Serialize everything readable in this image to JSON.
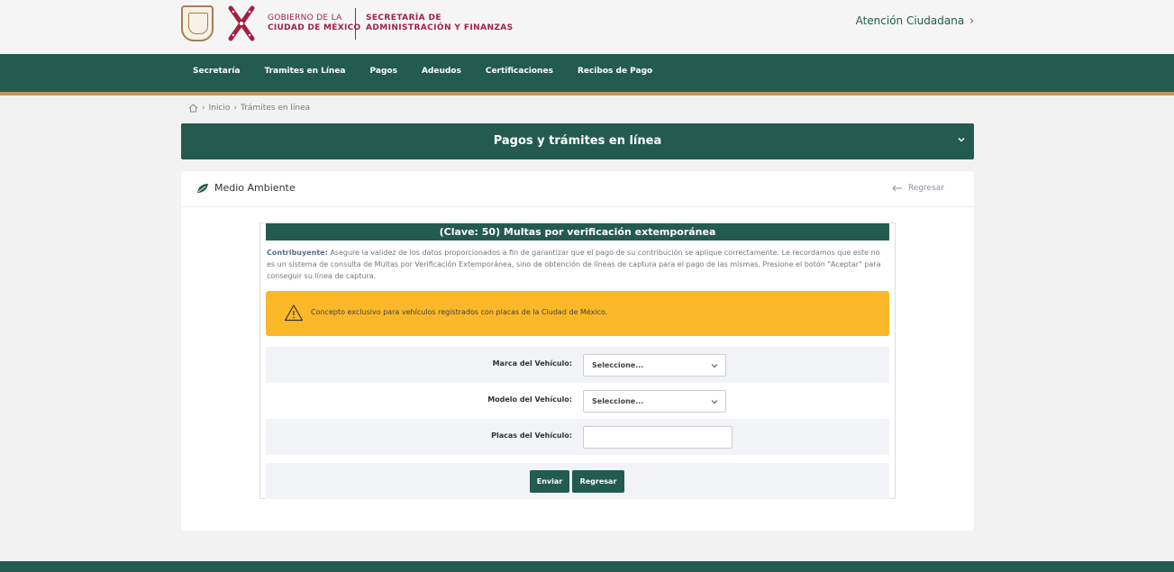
{
  "header": {
    "gov_line1": "GOBIERNO DE LA",
    "gov_line2": "CIUDAD DE MÉXICO",
    "sec_line1": "SECRETARÍA DE",
    "sec_line2": "ADMINISTRACIÓN Y FINANZAS",
    "atencion": "Atención Ciudadana"
  },
  "nav": {
    "items": [
      "Secretaría",
      "Tramites en Línea",
      "Pagos",
      "Adeudos",
      "Certificaciones",
      "Recibos de Pago"
    ]
  },
  "breadcrumb": {
    "inicio": "Inicio",
    "current": "Trámites en línea"
  },
  "accordion": {
    "title": "Pagos y trámites en línea"
  },
  "card": {
    "title": "Medio Ambiente",
    "back_label": "Regresar"
  },
  "form": {
    "title": "(Clave: 50) Multas por verificación extemporánea",
    "info_bold": "Contribuyente:",
    "info_text": " Asegure la validez de los datos proporcionados a fin de garantizar que el pago de su contribución se aplique correctamente. Le recordamos que este no es un sistema de consulta de Multas por Verificación Extemporánea, sino de obtención de líneas de captura para el pago de las mismas. Presione el botón \"Aceptar\" para conseguir su línea de captura.",
    "alert": "Concepto exclusivo para vehículos registrados con placas de la Ciudad de México.",
    "marca_label": "Marca del Vehículo:",
    "marca_value": "Seleccione...",
    "modelo_label": "Modelo del Vehículo:",
    "modelo_value": "Seleccione...",
    "placas_label": "Placas del Vehículo:",
    "placas_value": "",
    "enviar": "Enviar",
    "regresar": "Regresar"
  },
  "colors": {
    "primary_green": "#235b4e",
    "gold": "#bc955c",
    "wine": "#9f2241",
    "alert_yellow": "#fbb829"
  }
}
